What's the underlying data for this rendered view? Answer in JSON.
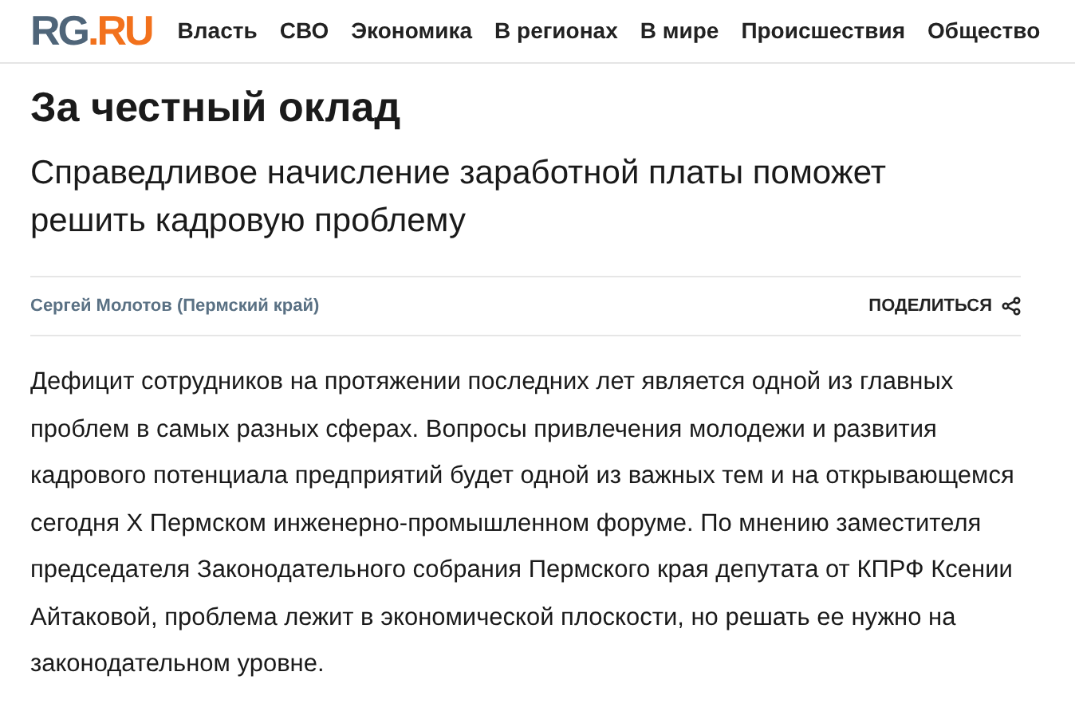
{
  "logo": {
    "part_1": "RG",
    "part_2": ".RU"
  },
  "nav": [
    "Власть",
    "СВО",
    "Экономика",
    "В регионах",
    "В мире",
    "Происшествия",
    "Общество"
  ],
  "article": {
    "title": "За честный оклад",
    "subtitle": "Справедливое начисление заработной платы поможет решить кадровую проблему",
    "author": "Сергей Молотов (Пермский край)",
    "share": "ПОДЕЛИТЬСЯ",
    "body": "Дефицит сотрудников на протяжении последних лет является одной из главных проблем в самых разных сферах. Вопросы привлечения молодежи и развития кадрового потенциала предприятий будет одной из важных тем и на открывающемся сегодня X Пермском инженерно-промышленном форуме. По мнению заместителя председателя Законодательного собрания Пермского края депутата от КПРФ Ксении Айтаковой, проблема лежит в экономической плоскости, но решать ее нужно на законодательном уровне."
  }
}
